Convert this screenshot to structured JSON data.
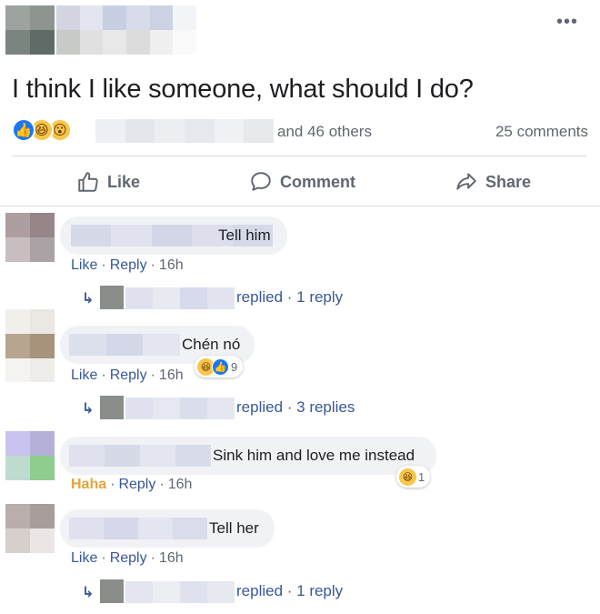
{
  "post": {
    "more_label": "•••",
    "text": "I think I like someone, what should I do?",
    "reactions": {
      "icons": [
        "like-icon",
        "haha-icon",
        "wow-icon"
      ],
      "and_others": "and 46 others",
      "comments_count": "25 comments"
    },
    "actions": {
      "like": "Like",
      "comment": "Comment",
      "share": "Share"
    }
  },
  "comments": [
    {
      "text": "Tell him",
      "meta": {
        "first": "Like",
        "reply": "Reply",
        "time": "16h"
      },
      "replies": "replied · 1 reply"
    },
    {
      "text": "Chén nó",
      "meta": {
        "first": "Like",
        "reply": "Reply",
        "time": "16h"
      },
      "reaction_count": "9",
      "replies": "replied · 3 replies"
    },
    {
      "text": "Sink him and love me instead",
      "meta": {
        "first": "Haha",
        "reply": "Reply",
        "time": "16h"
      },
      "reaction_count": "1"
    },
    {
      "text": "Tell her",
      "meta": {
        "first": "Like",
        "reply": "Reply",
        "time": "16h"
      },
      "replies": "replied · 1 reply"
    }
  ],
  "colors": {
    "link": "#385898",
    "muted": "#606770",
    "bubble": "#f0f2f5",
    "like_blue": "#1877f2",
    "haha_yellow": "#f7c64b",
    "haha_text": "#e5a43d"
  },
  "glyphs": {
    "dot": "·",
    "reply_arrow": "↳",
    "like_glyph": "👍",
    "haha_glyph": "😆",
    "wow_glyph": "😮"
  }
}
